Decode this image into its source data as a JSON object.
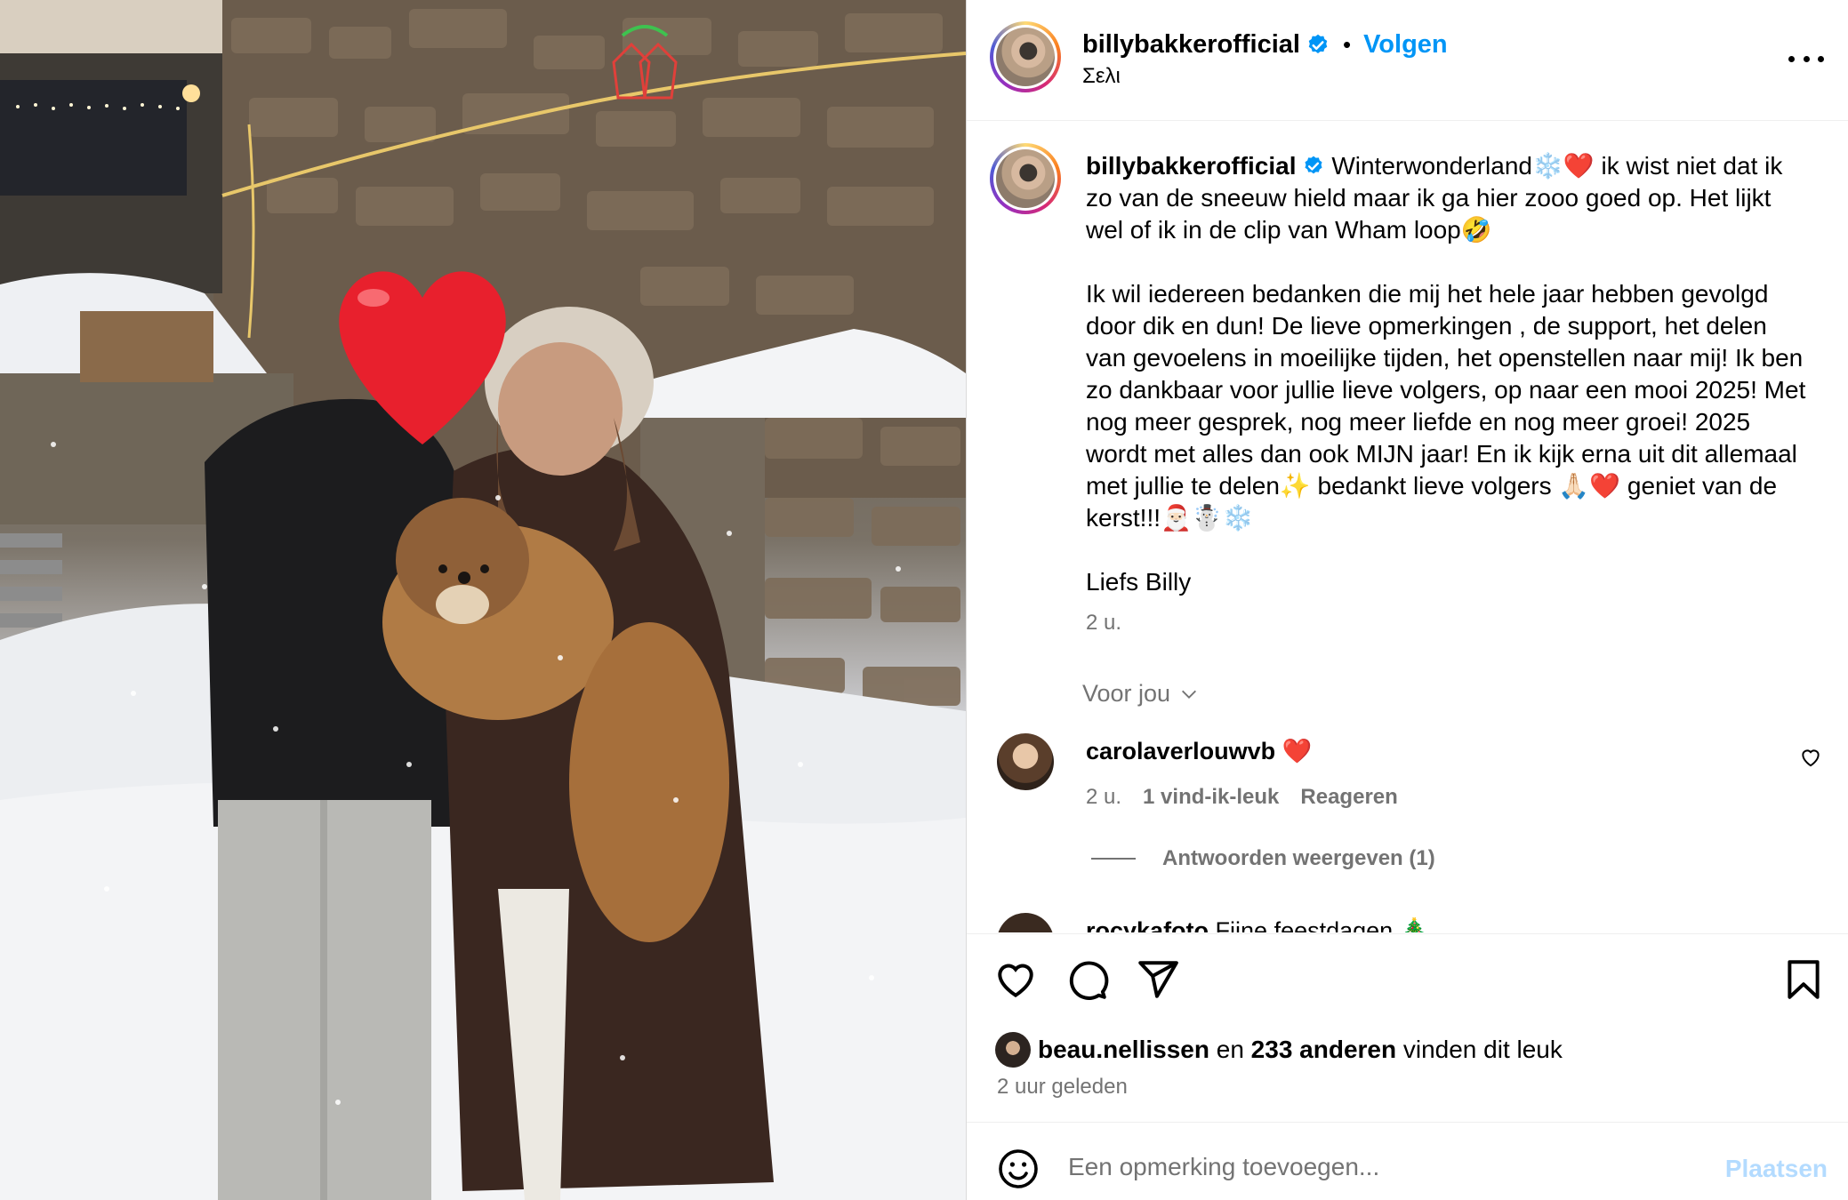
{
  "post": {
    "username": "billybakkerofficial",
    "follow_label": "Volgen",
    "dot": "•",
    "location": "Σελι"
  },
  "caption": {
    "username": "billybakkerofficial",
    "text": " Winterwonderland❄️❤️ ik wist niet dat ik zo van de sneeuw hield maar ik ga hier zooo goed op. Het lijkt wel of ik in de clip van Wham loop🤣\n\nIk wil iedereen bedanken die mij het hele jaar hebben gevolgd door dik en dun! De lieve opmerkingen , de support, het delen van gevoelens in moeilijke tijden, het openstellen naar mij! Ik ben zo dankbaar voor jullie lieve volgers, op naar een mooi 2025! Met nog meer gesprek, nog meer liefde en nog meer groei! 2025 wordt met alles dan ook MIJN jaar! En ik kijk erna uit dit allemaal met jullie te delen✨ bedankt lieve volgers 🙏🏻❤️ geniet van de kerst!!!🎅🏻☃️❄️\n\nLiefs Billy",
    "time": "2 u."
  },
  "for_you": "Voor jou",
  "comments": [
    {
      "username": "carolaverlouwvb",
      "text": " ❤️",
      "time": "2 u.",
      "likes": "1 vind-ik-leuk",
      "reply": "Reageren",
      "view_replies": "Antwoorden weergeven (1)"
    },
    {
      "username": "rocykafoto",
      "text": " Fijne feestdagen 🎄"
    }
  ],
  "likes": {
    "first_user": "beau.nellissen",
    "connector": " en ",
    "others": "233 anderen",
    "suffix": " vinden dit leuk"
  },
  "time_ago": "2 uur geleden",
  "add_comment": {
    "placeholder": "Een opmerking toevoegen...",
    "post_label": "Plaatsen"
  },
  "colors": {
    "accent": "#0095f6",
    "muted": "#737373",
    "post_disabled": "#b3dbff",
    "verified": "#0095f6"
  }
}
